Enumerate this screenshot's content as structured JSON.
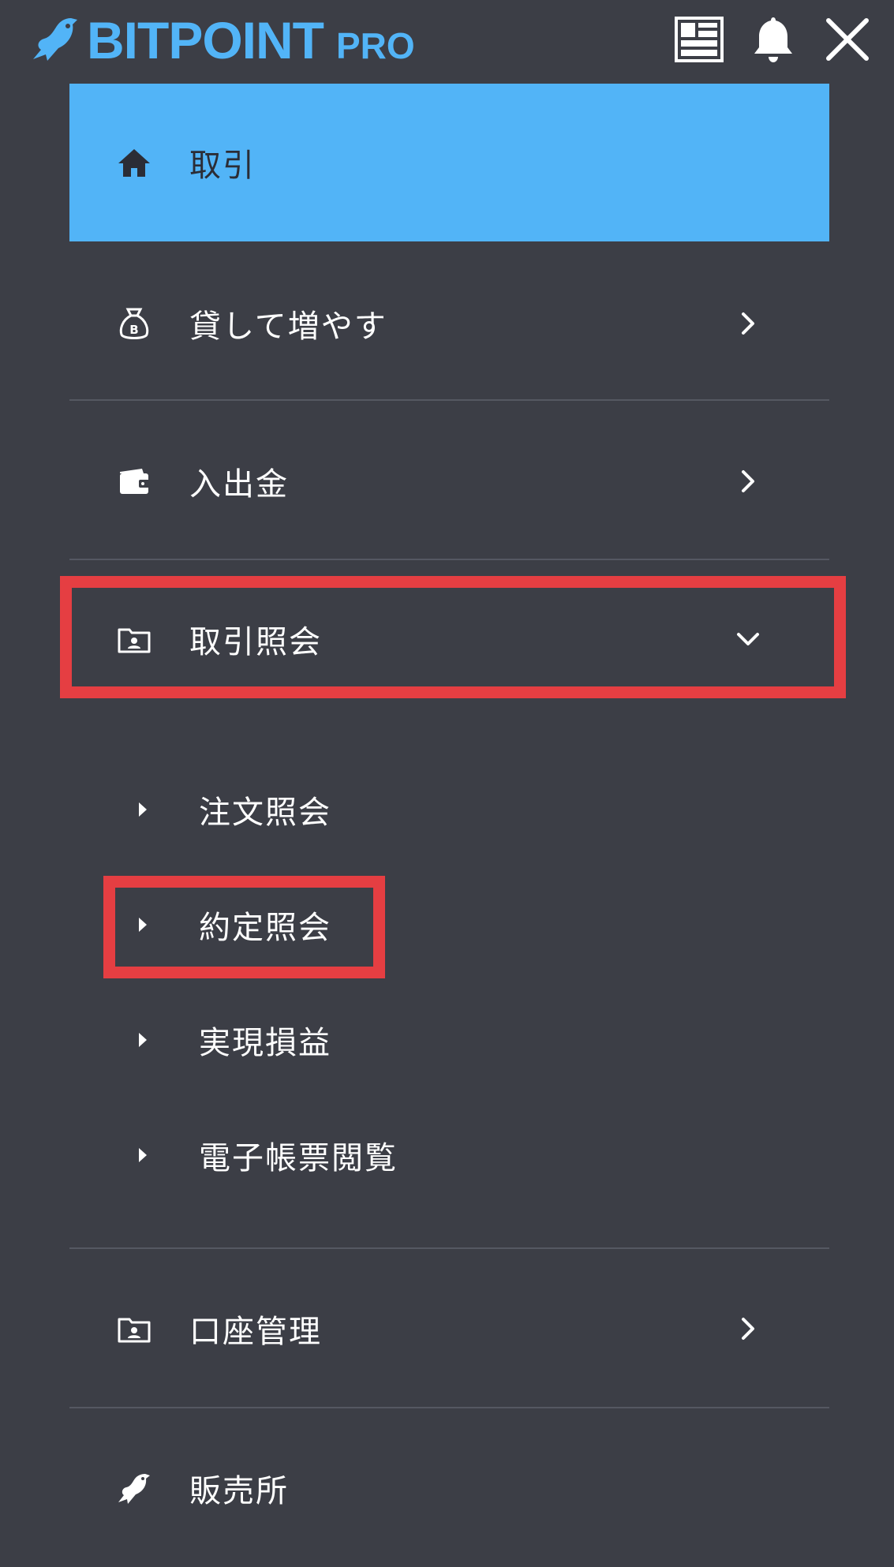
{
  "header": {
    "brand": "BITPOINT",
    "brand_suffix": "PRO",
    "icons": [
      "layout-icon",
      "bell-icon",
      "close-icon"
    ],
    "accent_color": "#52b4f7"
  },
  "menu": {
    "trade": "取引",
    "lend": "貸して増やす",
    "deposit": "入出金",
    "history": "取引照会",
    "history_sub": {
      "orders": "注文照会",
      "executions": "約定照会",
      "pnl": "実現損益",
      "reports": "電子帳票閲覧"
    },
    "account": "口座管理",
    "store": "販売所"
  },
  "highlight_color": "#e53e42"
}
